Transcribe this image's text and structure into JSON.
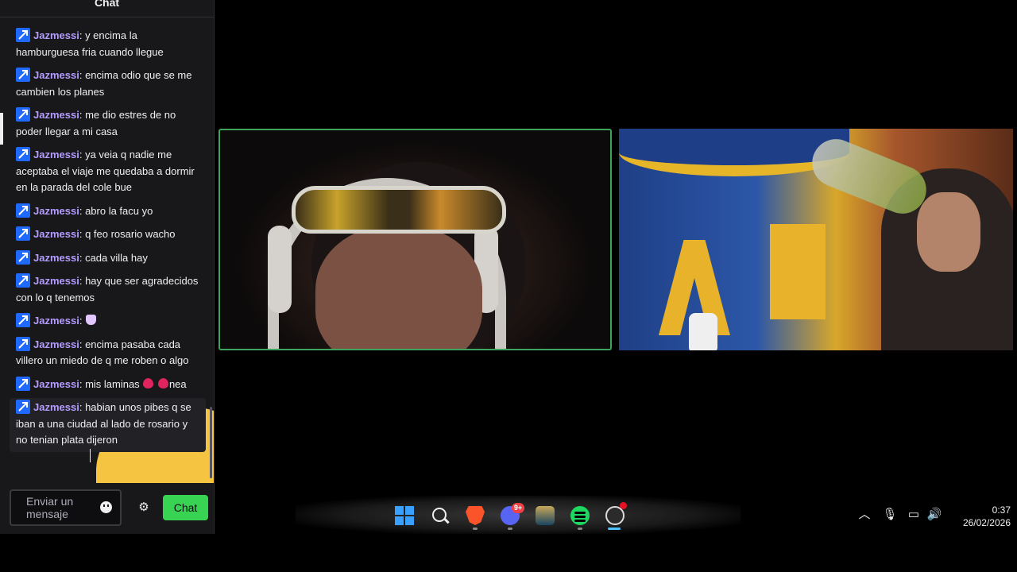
{
  "chat": {
    "title": "Chat",
    "messages": [
      {
        "user": "Jazmessi",
        "text": "y encima la hamburguesa fria cuando llegue"
      },
      {
        "user": "Jazmessi",
        "text": "encima odio que se me cambien los planes"
      },
      {
        "user": "Jazmessi",
        "text": "me dio estres de no poder llegar a mi casa"
      },
      {
        "user": "Jazmessi",
        "text": "ya veia q nadie me aceptaba el viaje me quedaba a dormir en la parada del cole bue"
      },
      {
        "user": "Jazmessi",
        "text": "abro la facu yo"
      },
      {
        "user": "Jazmessi",
        "text": "q feo rosario wacho"
      },
      {
        "user": "Jazmessi",
        "text": "cada villa hay"
      },
      {
        "user": "Jazmessi",
        "text": "hay que ser agradecidos con lo q tenemos"
      },
      {
        "user": "Jazmessi",
        "text": ""
      },
      {
        "user": "Jazmessi",
        "text": "encima pasaba cada villero un miedo de q me roben o algo"
      },
      {
        "user": "Jazmessi",
        "text": "mis laminas",
        "suffix": "nea"
      },
      {
        "user": "Jazmessi",
        "text": "habian unos pibes q se iban a una ciudad al lado de rosario y no tenian plata dijeron"
      }
    ],
    "input_placeholder": "Enviar un mensaje",
    "send_label": "Chat"
  },
  "taskbar": {
    "discord_badge": "9+",
    "time": "0:37",
    "date": "26/02/2026"
  },
  "icons": [
    "badge-icon",
    "emoji-icon",
    "gear-icon",
    "windows-start-icon",
    "search-icon",
    "brave-icon",
    "discord-icon",
    "league-of-legends-icon",
    "spotify-icon",
    "obs-icon",
    "chevron-up-icon",
    "microphone-icon",
    "network-icon",
    "volume-icon"
  ],
  "colors": {
    "username": "#b49cff",
    "send_button": "#39d353",
    "cam_border": "#3ea45a",
    "badge": "#1f69ff"
  }
}
